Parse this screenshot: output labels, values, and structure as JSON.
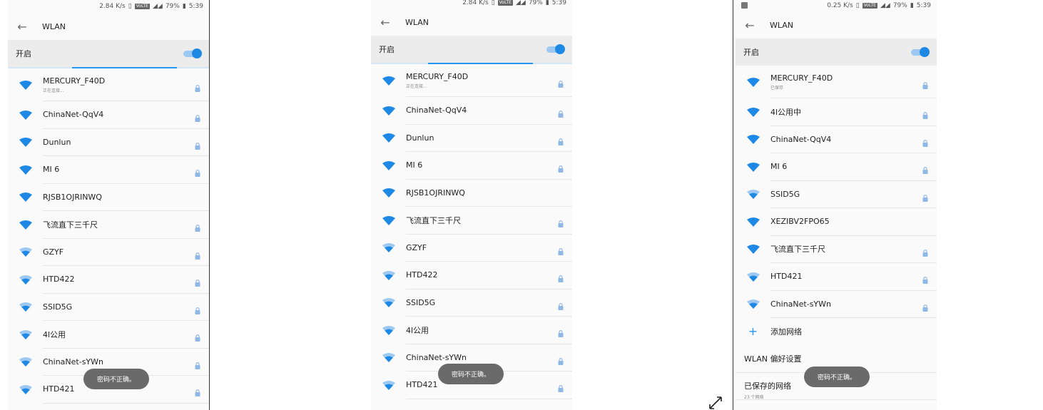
{
  "panels": [
    {
      "status": {
        "speed": "2.84 K/s",
        "lte": "VoLTE",
        "battery": "79%",
        "time": "5:39"
      },
      "appbar": {
        "back_icon": "arrow-left-icon",
        "title": "WLAN"
      },
      "wlan_switch": {
        "label": "开启",
        "on": true
      },
      "networks": [
        {
          "name": "MERCURY_F40D",
          "sub": "正在连接...",
          "signal": 4,
          "locked": true
        },
        {
          "name": "ChinaNet-QqV4",
          "signal": 4,
          "locked": true
        },
        {
          "name": "Dunlun",
          "signal": 4,
          "locked": true
        },
        {
          "name": "MI 6",
          "signal": 4,
          "locked": true
        },
        {
          "name": "RJSB1OJRINWQ",
          "signal": 4,
          "locked": false
        },
        {
          "name": "飞流直下三千尺",
          "signal": 4,
          "locked": true
        },
        {
          "name": "GZYF",
          "signal": 3,
          "locked": true
        },
        {
          "name": "HTD422",
          "signal": 3,
          "locked": true
        },
        {
          "name": "SSID5G",
          "signal": 3,
          "locked": true
        },
        {
          "name": "4l公用",
          "signal": 3,
          "locked": true
        },
        {
          "name": "ChinaNet-sYWn",
          "signal": 3,
          "locked": true
        },
        {
          "name": "HTD421",
          "signal": 3,
          "locked": true
        }
      ],
      "toast": "密码不正确。"
    },
    {
      "status": {
        "speed": "2.84 K/s",
        "lte": "VoLTE",
        "battery": "79%",
        "time": "5:39"
      },
      "appbar": {
        "back_icon": "arrow-left-icon",
        "title": "WLAN"
      },
      "wlan_switch": {
        "label": "开启",
        "on": true
      },
      "networks": [
        {
          "name": "MERCURY_F40D",
          "sub": "正在连接...",
          "signal": 4,
          "locked": true
        },
        {
          "name": "ChinaNet-QqV4",
          "signal": 4,
          "locked": true
        },
        {
          "name": "Dunlun",
          "signal": 4,
          "locked": true
        },
        {
          "name": "MI 6",
          "signal": 4,
          "locked": true
        },
        {
          "name": "RJSB1OJRINWQ",
          "signal": 4,
          "locked": false
        },
        {
          "name": "飞流直下三千尺",
          "signal": 4,
          "locked": true
        },
        {
          "name": "GZYF",
          "signal": 3,
          "locked": true
        },
        {
          "name": "HTD422",
          "signal": 3,
          "locked": true
        },
        {
          "name": "SSID5G",
          "signal": 3,
          "locked": true
        },
        {
          "name": "4l公用",
          "signal": 3,
          "locked": true
        },
        {
          "name": "ChinaNet-sYWn",
          "signal": 3,
          "locked": true
        },
        {
          "name": "HTD421",
          "signal": 3,
          "locked": true
        }
      ],
      "toast": "密码不正确。"
    },
    {
      "status": {
        "speed": "0.25 K/s",
        "lte": "VoLTE",
        "battery": "79%",
        "time": "5:39"
      },
      "appbar": {
        "back_icon": "arrow-left-icon",
        "title": "WLAN"
      },
      "wlan_switch": {
        "label": "开启",
        "on": true
      },
      "networks": [
        {
          "name": "MERCURY_F40D",
          "sub": "已保存",
          "signal": 4,
          "locked": true
        },
        {
          "name": "4l公用中",
          "signal": 4,
          "locked": true
        },
        {
          "name": "ChinaNet-QqV4",
          "signal": 4,
          "locked": true
        },
        {
          "name": "MI 6",
          "signal": 4,
          "locked": true
        },
        {
          "name": "SSID5G",
          "signal": 3,
          "locked": true
        },
        {
          "name": "XEZIBV2FPO65",
          "signal": 4,
          "locked": false
        },
        {
          "name": "飞流直下三千尺",
          "signal": 4,
          "locked": true
        },
        {
          "name": "HTD421",
          "signal": 3,
          "locked": true
        },
        {
          "name": "ChinaNet-sYWn",
          "signal": 3,
          "locked": true
        }
      ],
      "add_network": "添加网络",
      "settings": [
        {
          "name": "WLAN 偏好设置"
        },
        {
          "name": "已保存的网络",
          "sub": "23 个网络"
        }
      ],
      "toast": "密码不正确。"
    }
  ],
  "expand_icon": "expand-arrows-icon",
  "colors": {
    "accent": "#2196f3",
    "wifi": "#1e88e5",
    "toast": "#6a6a6a",
    "switch_bg": "#ececec"
  }
}
